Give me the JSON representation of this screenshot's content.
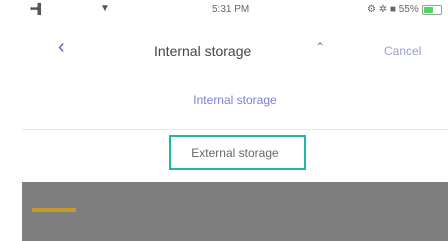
{
  "status_bar": {
    "signal": "•••▌",
    "wifi": "▼",
    "time": "5:31 PM",
    "right_status": "⚙ ✲ ■ 55%"
  },
  "nav": {
    "back_icon": "‹",
    "title": "Internal storage",
    "caret": "⌃",
    "cancel_label": "Cancel"
  },
  "menu": {
    "items": [
      {
        "label": "Internal storage"
      },
      {
        "label": "External storage"
      }
    ]
  },
  "colors": {
    "accent": "#5a5fd6",
    "highlight": "#1eb8a8",
    "overlay": "#7f7f7f"
  }
}
